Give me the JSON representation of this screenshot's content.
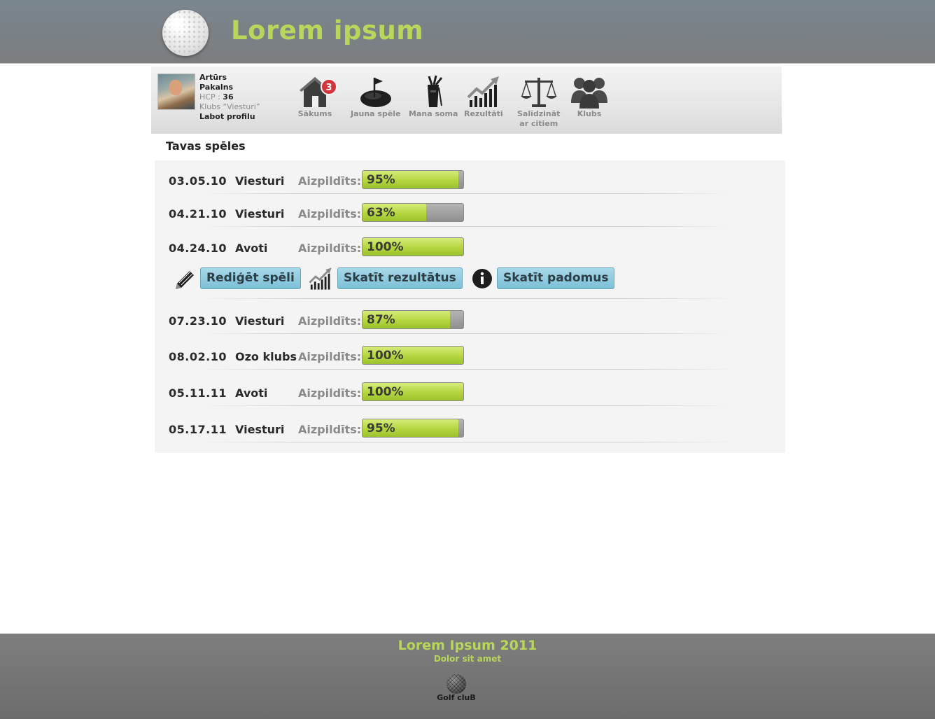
{
  "header": {
    "title": "Lorem ipsum"
  },
  "profile": {
    "first_name": "Artūrs",
    "last_name": "Pakalns",
    "hcp_label": "HCP :",
    "hcp_value": "36",
    "club": "Klubs “Viesturi”",
    "edit_link": "Labot profilu"
  },
  "nav": {
    "items": [
      {
        "label": "Sākums",
        "icon": "home-icon",
        "badge": "3"
      },
      {
        "label": "Jauna spēle",
        "icon": "golf-green-icon"
      },
      {
        "label": "Mana soma",
        "icon": "golf-bag-icon"
      },
      {
        "label": "Rezultāti",
        "icon": "chart-up-icon"
      },
      {
        "label": "Salīdzināt",
        "label2": "ar citiem",
        "icon": "scales-icon"
      },
      {
        "label": "Klubs",
        "icon": "people-icon"
      }
    ]
  },
  "section_title": "Tavas spēles",
  "completed_label": "Aizpildīts:",
  "games": [
    {
      "date": "03.05.10",
      "club": "Viesturi",
      "progress": 95,
      "progress_label": "95%"
    },
    {
      "date": "04.21.10",
      "club": "Viesturi",
      "progress": 63,
      "progress_label": "63%"
    },
    {
      "date": "04.24.10",
      "club": "Avoti",
      "progress": 100,
      "progress_label": "100%"
    },
    {
      "date": "07.23.10",
      "club": "Viesturi",
      "progress": 87,
      "progress_label": "87%"
    },
    {
      "date": "08.02.10",
      "club": "Ozo klubs",
      "progress": 100,
      "progress_label": "100%"
    },
    {
      "date": "05.11.11",
      "club": "Avoti",
      "progress": 100,
      "progress_label": "100%"
    },
    {
      "date": "05.17.11",
      "club": "Viesturi",
      "progress": 95,
      "progress_label": "95%"
    }
  ],
  "actions": {
    "edit": "Rediģēt spēli",
    "results": "Skatīt rezultātus",
    "tips": "Skatīt padomus"
  },
  "footer": {
    "title": "Lorem Ipsum 2011",
    "subtitle": "Dolor sit amet",
    "logo_text": "Golf cluB"
  },
  "colors": {
    "accent_green": "#b7d65a",
    "progress_fill": "#b4d640",
    "button_blue": "#7cc0d8",
    "badge_red": "#d4333a"
  }
}
